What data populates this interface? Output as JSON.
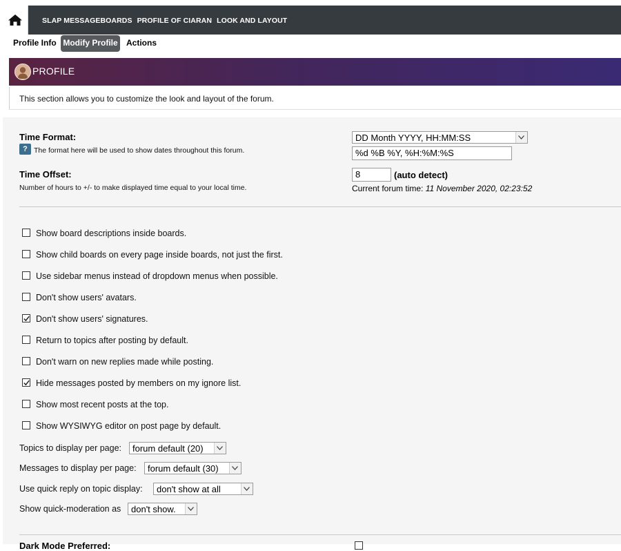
{
  "breadcrumb": [
    "SLAP MESSAGEBOARDS",
    "PROFILE OF CIARAN",
    "LOOK AND LAYOUT"
  ],
  "tabs": [
    {
      "label": "Profile Info",
      "active": false
    },
    {
      "label": "Modify Profile",
      "active": true
    },
    {
      "label": "Actions",
      "active": false
    }
  ],
  "section": {
    "title": "PROFILE",
    "description": "This section allows you to customize the look and layout of the forum."
  },
  "time_format": {
    "label": "Time Format:",
    "help": "The format here will be used to show dates throughout this forum.",
    "help_icon": "?",
    "selected": "DD Month YYYY, HH:MM:SS",
    "value": "%d %B %Y, %H:%M:%S"
  },
  "time_offset": {
    "label": "Time Offset:",
    "help": "Number of hours to +/- to make displayed time equal to your local time.",
    "value": "8",
    "auto_detect": "(auto detect)",
    "current_label": "Current forum time:",
    "current_value": "11 November 2020, 02:23:52"
  },
  "options": [
    {
      "label": "Show board descriptions inside boards.",
      "checked": false
    },
    {
      "label": "Show child boards on every page inside boards, not just the first.",
      "checked": false
    },
    {
      "label": "Use sidebar menus instead of dropdown menus when possible.",
      "checked": false
    },
    {
      "label": "Don't show users' avatars.",
      "checked": false
    },
    {
      "label": "Don't show users' signatures.",
      "checked": true
    },
    {
      "label": "Return to topics after posting by default.",
      "checked": false
    },
    {
      "label": "Don't warn on new replies made while posting.",
      "checked": false
    },
    {
      "label": "Hide messages posted by members on my ignore list.",
      "checked": true
    },
    {
      "label": "Show most recent posts at the top.",
      "checked": false
    },
    {
      "label": "Show WYSIWYG editor on post page by default.",
      "checked": false
    }
  ],
  "selects": [
    {
      "label": "Topics to display per page:",
      "value": "forum default (20)"
    },
    {
      "label": "Messages to display per page:",
      "value": "forum default (30)"
    },
    {
      "label": "Use quick reply on topic display:",
      "value": "don't show at all"
    },
    {
      "label": "Show quick-moderation as",
      "value": "don't show."
    }
  ],
  "next_section": {
    "label": "Dark Mode Preferred:"
  }
}
